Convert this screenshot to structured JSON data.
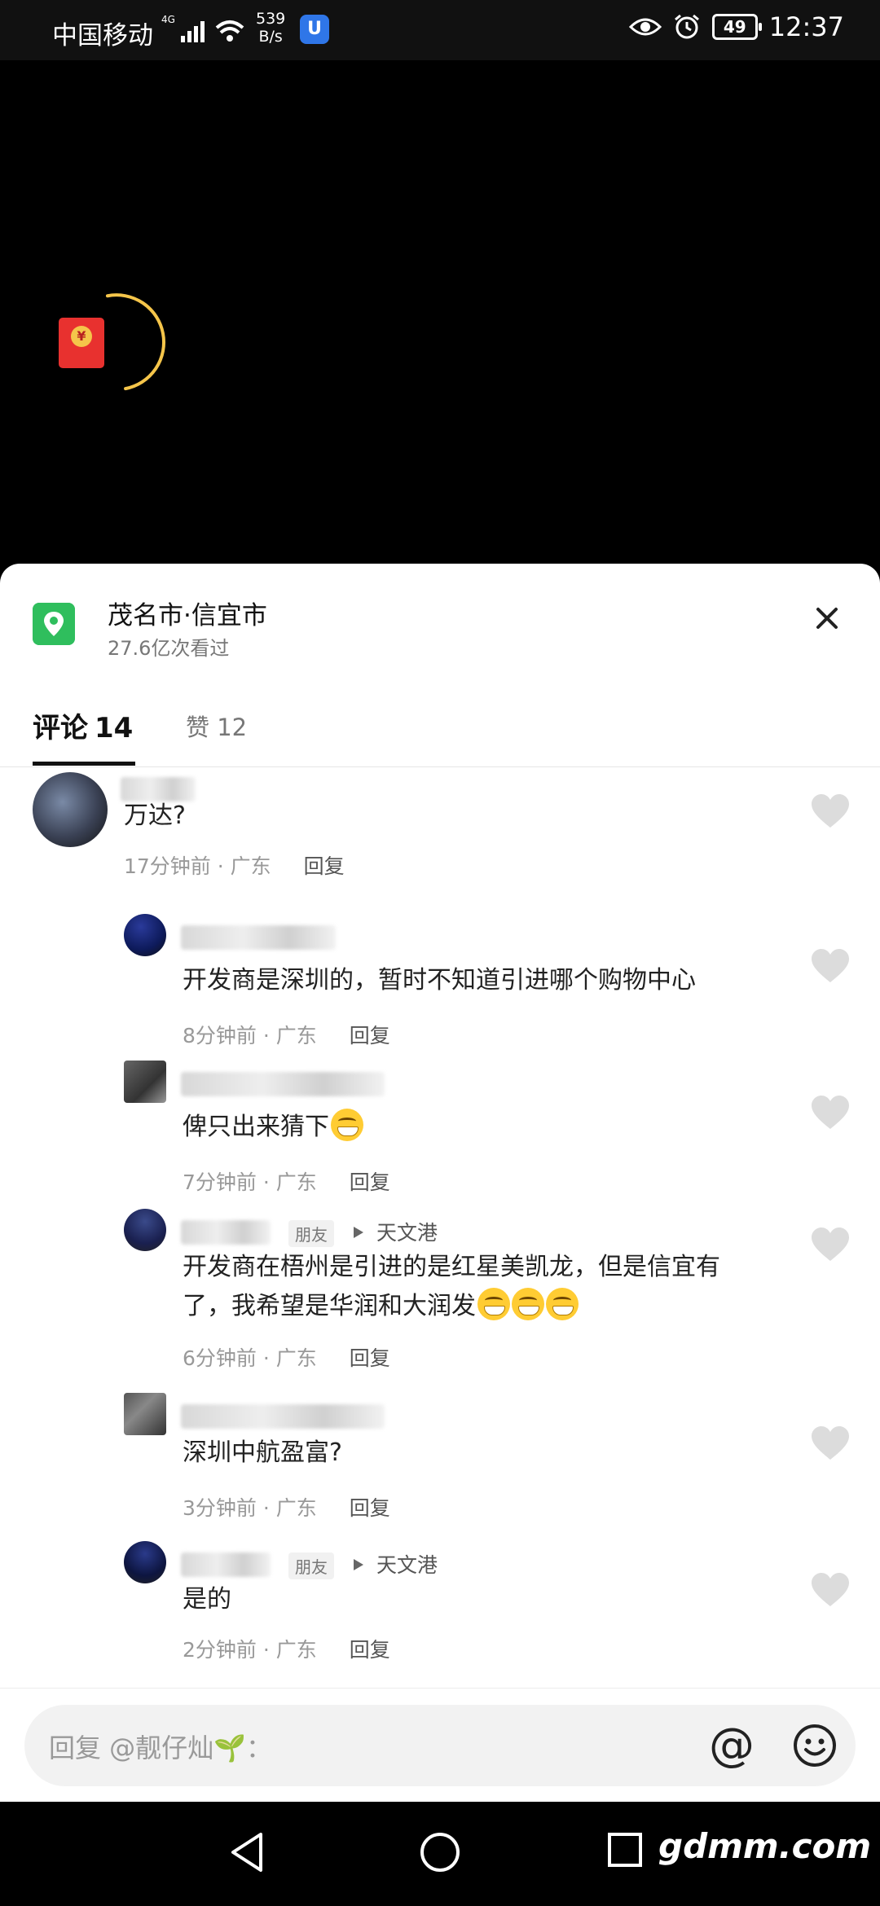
{
  "status_bar": {
    "carrier": "中国移动",
    "net_speed_value": "539",
    "net_speed_unit": "B/s",
    "battery": "49",
    "time": "12:37"
  },
  "location": {
    "title": "茂名市·信宜市",
    "views": "27.6亿次看过"
  },
  "tabs": {
    "comments_label": "评论",
    "comments_count": "14",
    "likes_label": "赞 12"
  },
  "comments": [
    {
      "text": "万达?",
      "time": "17分钟前",
      "region": "广东",
      "reply": "回复"
    },
    {
      "text": "开发商是深圳的，暂时不知道引进哪个购物中心",
      "time": "8分钟前",
      "region": "广东",
      "reply": "回复"
    },
    {
      "text": "俾只出来猜下",
      "time": "7分钟前",
      "region": "广东",
      "reply": "回复"
    },
    {
      "text_line1": "开发商在梧州是引进的是红星美凯龙，但是信宜有",
      "text_line2": "了，我希望是华润和大润发",
      "friend_tag": "朋友",
      "place": "天文港",
      "time": "6分钟前",
      "region": "广东",
      "reply": "回复"
    },
    {
      "text": "深圳中航盈富?",
      "time": "3分钟前",
      "region": "广东",
      "reply": "回复"
    },
    {
      "text": "是的",
      "friend_tag": "朋友",
      "place": "天文港",
      "time": "2分钟前",
      "region": "广东",
      "reply": "回复"
    }
  ],
  "meta_sep": " · ",
  "input": {
    "placeholder": "回复 @靓仔灿🌱："
  },
  "watermark": "gdmm.com",
  "colors": {
    "location_icon": "#2fbe5d",
    "red_packet": "#e8312f"
  }
}
